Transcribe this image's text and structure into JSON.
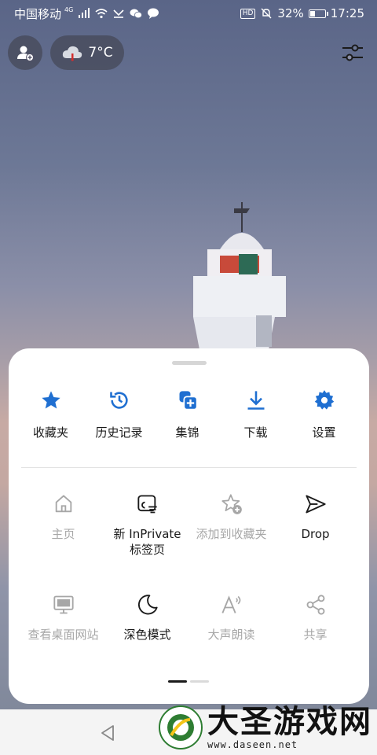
{
  "status_bar": {
    "carrier": "中国移动",
    "network": "4G",
    "hd": "HD",
    "battery": "32%",
    "battery_level": 0.32,
    "time": "17:25"
  },
  "weather": {
    "temperature": "7°C"
  },
  "menu": {
    "row1": [
      {
        "label": "收藏夹",
        "icon": "star-icon"
      },
      {
        "label": "历史记录",
        "icon": "history-icon"
      },
      {
        "label": "集锦",
        "icon": "collections-icon"
      },
      {
        "label": "下载",
        "icon": "download-icon"
      },
      {
        "label": "设置",
        "icon": "gear-icon"
      }
    ],
    "row2": [
      {
        "label": "主页",
        "icon": "home-icon",
        "enabled": false
      },
      {
        "label": "新 InPrivate\n标签页",
        "icon": "inprivate-tab-icon",
        "enabled": true
      },
      {
        "label": "添加到收藏夹",
        "icon": "add-favorite-icon",
        "enabled": false
      },
      {
        "label": "Drop",
        "icon": "send-icon",
        "enabled": true
      }
    ],
    "row3": [
      {
        "label": "查看桌面网站",
        "icon": "desktop-icon",
        "enabled": false
      },
      {
        "label": "深色模式",
        "icon": "moon-icon",
        "enabled": true
      },
      {
        "label": "大声朗读",
        "icon": "read-aloud-icon",
        "enabled": false
      },
      {
        "label": "共享",
        "icon": "share-icon",
        "enabled": false
      }
    ]
  },
  "pager": {
    "current": 1,
    "total": 2
  },
  "watermark": {
    "title": "大圣游戏网",
    "url": "www.daseen.net"
  },
  "colors": {
    "accent": "#1f6fd1",
    "disabled": "#a7a7a7",
    "text": "#1a1a1a"
  }
}
